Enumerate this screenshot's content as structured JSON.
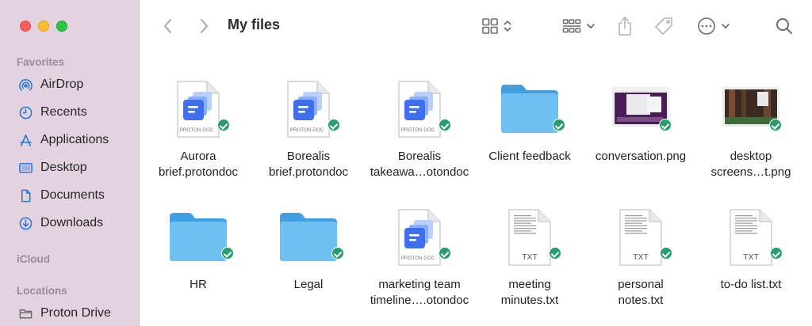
{
  "window": {
    "title": "My files"
  },
  "sidebar": {
    "favorites_label": "Favorites",
    "favorites": [
      {
        "label": "AirDrop",
        "icon": "airdrop-icon"
      },
      {
        "label": "Recents",
        "icon": "clock-icon"
      },
      {
        "label": "Applications",
        "icon": "applications-icon"
      },
      {
        "label": "Desktop",
        "icon": "desktop-icon"
      },
      {
        "label": "Documents",
        "icon": "document-icon"
      },
      {
        "label": "Downloads",
        "icon": "download-icon"
      }
    ],
    "icloud_label": "iCloud",
    "locations_label": "Locations",
    "locations": [
      {
        "label": "Proton Drive",
        "icon": "folder-icon"
      }
    ]
  },
  "toolbar": {
    "back": "chevron-left-icon",
    "forward": "chevron-right-icon",
    "view": "grid-view-icon",
    "group": "group-icon",
    "share": "share-icon",
    "tag": "tag-icon",
    "more": "ellipsis-circle-icon",
    "search": "search-icon"
  },
  "files": [
    {
      "name1": "Aurora",
      "name2": "brief.protondoc",
      "kind": "protondoc",
      "badge": "PROTON DOC"
    },
    {
      "name1": "Borealis",
      "name2": "brief.protondoc",
      "kind": "protondoc",
      "badge": "PROTON DOC"
    },
    {
      "name1": "Borealis",
      "name2": "takeawa…otondoc",
      "kind": "protondoc",
      "badge": "PROTON DOC"
    },
    {
      "name1": "Client feedback",
      "name2": "",
      "kind": "folder"
    },
    {
      "name1": "conversation.png",
      "name2": "",
      "kind": "image-purple"
    },
    {
      "name1": "desktop",
      "name2": "screens…t.png",
      "kind": "image-forest"
    },
    {
      "name1": "HR",
      "name2": "",
      "kind": "folder"
    },
    {
      "name1": "Legal",
      "name2": "",
      "kind": "folder"
    },
    {
      "name1": "marketing team",
      "name2": "timeline….otondoc",
      "kind": "protondoc",
      "badge": "PROTON DOC"
    },
    {
      "name1": "meeting",
      "name2": "minutes.txt",
      "kind": "txt",
      "badge": "TXT"
    },
    {
      "name1": "personal",
      "name2": "notes.txt",
      "kind": "txt",
      "badge": "TXT"
    },
    {
      "name1": "to-do list.txt",
      "name2": "",
      "kind": "txt",
      "badge": "TXT"
    }
  ],
  "colors": {
    "sidebar": "#e3d2df",
    "sync_check": "#2a9d6f",
    "folder": "#6fc0f3",
    "proton_blue": "#3d6ff0"
  }
}
